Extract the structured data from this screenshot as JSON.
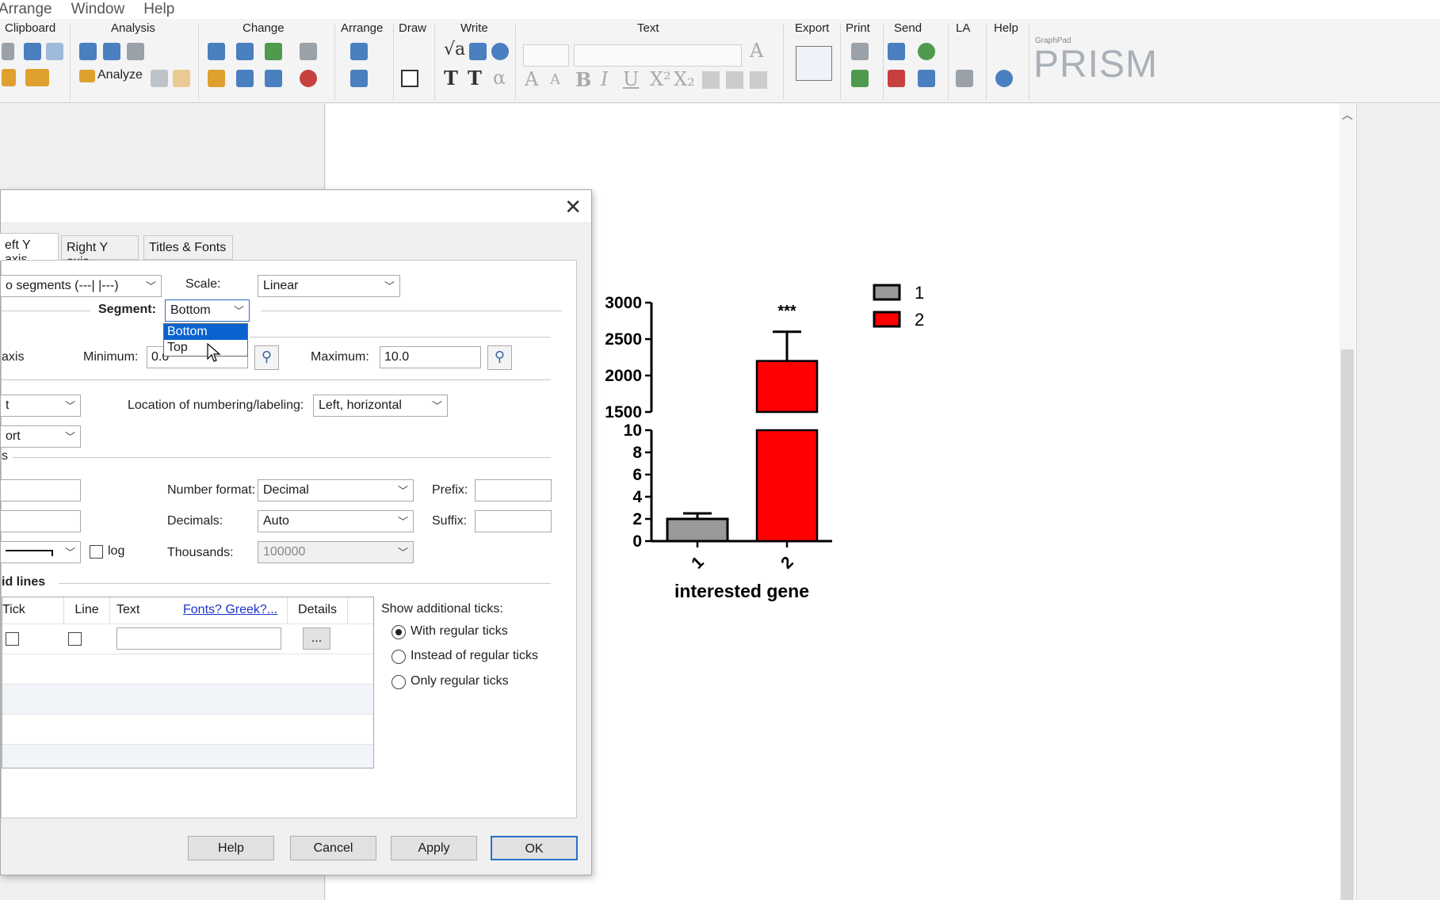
{
  "menubar": {
    "items": [
      "Arrange",
      "Window",
      "Help"
    ]
  },
  "ribbon": {
    "groups": [
      "Clipboard",
      "Analysis",
      "Change",
      "Arrange",
      "Draw",
      "Write",
      "Text",
      "Export",
      "Print",
      "Send",
      "LA",
      "Help"
    ],
    "analyze_label": "Analyze",
    "logo_small": "GraphPad",
    "logo_text": "PRISM"
  },
  "dialog": {
    "tabs": [
      "eft Y axis",
      "Right Y axis",
      "Titles & Fonts"
    ],
    "gaps_select": "o segments (---| |---)",
    "scale_label": "Scale:",
    "scale_value": "Linear",
    "segment_label": "Segment:",
    "segment_value": "Bottom",
    "segment_options": [
      "Bottom",
      "Top"
    ],
    "range_label": "axis",
    "minimum_label": "Minimum:",
    "minimum_value": "0.0",
    "maximum_label": "Maximum:",
    "maximum_value": "10.0",
    "dir_select": "t",
    "tick_select": "ort",
    "location_label": "Location of numbering/labeling:",
    "location_value": "Left, horizontal",
    "numbering_heading": "s",
    "number_format_label": "Number format:",
    "number_format_value": "Decimal",
    "decimals_label": "Decimals:",
    "decimals_value": "Auto",
    "thousands_label": "Thousands:",
    "thousands_value": "100000",
    "prefix_label": "Prefix:",
    "suffix_label": "Suffix:",
    "log_label": "log",
    "gridlines_heading": "id lines",
    "grid_headers": {
      "tick": "Tick",
      "line": "Line",
      "text": "Text",
      "fonts_link": "Fonts? Greek?...",
      "details": "Details"
    },
    "details_btn": "...",
    "show_ticks_label": "Show additional ticks:",
    "radio_options": [
      "With regular ticks",
      "Instead of regular ticks",
      "Only regular ticks"
    ],
    "buttons": {
      "help": "Help",
      "cancel": "Cancel",
      "apply": "Apply",
      "ok": "OK"
    }
  },
  "chart_data": {
    "type": "bar",
    "categories": [
      "1",
      "2"
    ],
    "values": [
      2,
      2200
    ],
    "error_plus": [
      0.5,
      400
    ],
    "colors": [
      "#999999",
      "#ff0000"
    ],
    "xlabel": "interested gene",
    "significance": "***",
    "legend": [
      "1",
      "2"
    ],
    "y_axis_top_segment": {
      "ylim": [
        1500,
        3000
      ],
      "ticks": [
        "3000",
        "2500",
        "2000",
        "1500"
      ]
    },
    "y_axis_bottom_segment": {
      "ylim": [
        0,
        10
      ],
      "ticks": [
        "10",
        "8",
        "6",
        "4",
        "2",
        "0"
      ]
    },
    "x_tick_labels": [
      "1",
      "2"
    ]
  }
}
